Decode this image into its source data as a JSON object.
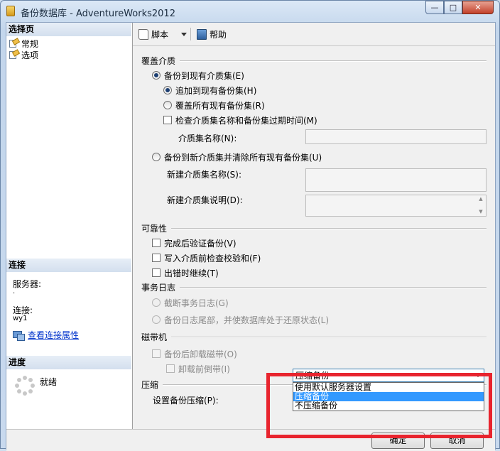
{
  "window": {
    "title": "备份数据库 - AdventureWorks2012"
  },
  "left": {
    "select_page_header": "选择页",
    "pages": [
      {
        "label": "常规"
      },
      {
        "label": "选项"
      }
    ],
    "connection_header": "连接",
    "server_label": "服务器:",
    "server_value": ".",
    "connection_label": "连接:",
    "connection_value": "wy1",
    "view_connection_link": "查看连接属性",
    "progress_header": "进度",
    "progress_status": "就绪"
  },
  "toolbar": {
    "script_label": "脚本",
    "help_label": "帮助"
  },
  "overwrite": {
    "group_title": "覆盖介质",
    "existing_media": "备份到现有介质集(E)",
    "append": "追加到现有备份集(H)",
    "overwrite_all": "覆盖所有现有备份集(R)",
    "check_name_expiry": "检查介质集名称和备份集过期时间(M)",
    "media_name_label": "介质集名称(N):",
    "new_media": "备份到新介质集并清除所有现有备份集(U)",
    "new_media_name_label": "新建介质集名称(S):",
    "new_media_desc_label": "新建介质集说明(D):"
  },
  "reliability": {
    "group_title": "可靠性",
    "verify": "完成后验证备份(V)",
    "checksum": "写入介质前检查校验和(F)",
    "continue_on_error": "出错时继续(T)"
  },
  "txlog": {
    "group_title": "事务日志",
    "truncate": "截断事务日志(G)",
    "tail": "备份日志尾部，并使数据库处于还原状态(L)"
  },
  "tape": {
    "group_title": "磁带机",
    "unload": "备份后卸载磁带(O)",
    "rewind": "卸载前倒带(I)"
  },
  "compression": {
    "group_title": "压缩",
    "label": "设置备份压缩(P):",
    "selected": "压缩备份",
    "options": [
      "使用默认服务器设置",
      "压缩备份",
      "不压缩备份"
    ]
  },
  "footer": {
    "ok_label": "确定",
    "cancel_label": "取消"
  },
  "colors": {
    "highlight_box": "#e8242e",
    "selection": "#3399ff",
    "link": "#0033cc"
  }
}
